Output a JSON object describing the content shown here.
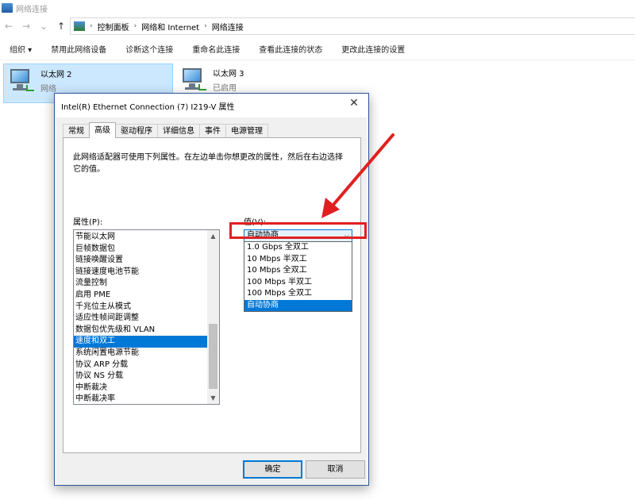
{
  "window": {
    "title": "网络连接"
  },
  "nav": {
    "back": "←",
    "forward": "→",
    "recent": "⌄",
    "up": "↑"
  },
  "breadcrumb": [
    "控制面板",
    "网络和 Internet",
    "网络连接"
  ],
  "commandbar": [
    "组织 ▾",
    "禁用此网络设备",
    "诊断这个连接",
    "重命名此连接",
    "查看此连接的状态",
    "更改此连接的设置"
  ],
  "adapters": [
    {
      "name": "以太网 2",
      "status": "网络"
    },
    {
      "name": "以太网 3",
      "status": "已启用"
    }
  ],
  "dialog": {
    "title": "Intel(R) Ethernet Connection (7) I219-V 属性",
    "close": "✕",
    "tabs": [
      "常规",
      "高级",
      "驱动程序",
      "详细信息",
      "事件",
      "电源管理"
    ],
    "active_tab": "高级",
    "description": "此网络适配器可使用下列属性。在左边单击你想更改的属性，然后在右边选择它的值。",
    "property_label": "属性(P):",
    "value_label": "值(V):",
    "properties": [
      "节能以太网",
      "巨帧数据包",
      "链接唤醒设置",
      "链接速度电池节能",
      "流量控制",
      "启用 PME",
      "千兆位主从模式",
      "适应性帧间距调整",
      "数据包优先级和 VLAN",
      "速度和双工",
      "系统闲置电源节能",
      "协议 ARP 分载",
      "协议 NS 分载",
      "中断裁决",
      "中断裁决率"
    ],
    "selected_property": "速度和双工",
    "value_current": "自动协商",
    "value_options": [
      "1.0 Gbps 全双工",
      "10 Mbps 半双工",
      "10 Mbps 全双工",
      "100 Mbps 半双工",
      "100 Mbps 全双工",
      "自动协商"
    ],
    "ok_label": "确定",
    "cancel_label": "取消"
  },
  "colors": {
    "selection": "#0078d7",
    "annotation": "#e02020",
    "dialog_border": "#2b579a"
  }
}
